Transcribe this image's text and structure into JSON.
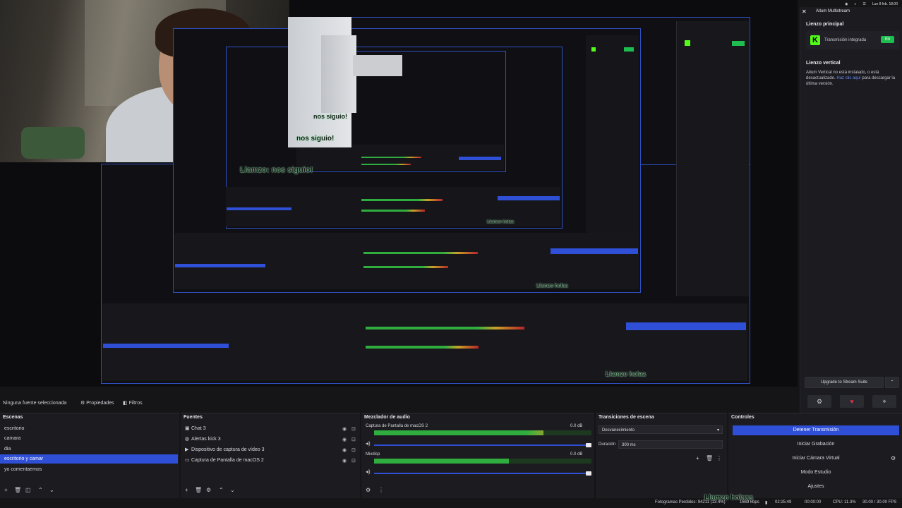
{
  "system_bar": {
    "datetime": "Lun 8 feb. 18:00"
  },
  "stream_dock": {
    "title": "Aitum Multistream",
    "main_section_title": "Lienzo principal",
    "platform_letter": "K",
    "integrated_label": "Transmisión integrada",
    "live_badge": "En",
    "vertical_section_title": "Lienzo vertical",
    "vertical_text_1": "Aitum Vertical no está instalado, o está desactualizado.",
    "vertical_link": "Haz clic aquí",
    "vertical_text_2": "para descargar la última versión.",
    "upgrade_button": "Upgrade to Stream Suite",
    "icons": [
      "gear-icon",
      "heart-icon",
      "pin-icon"
    ]
  },
  "preview": {
    "overlay_texts": [
      "nos siguio!",
      "nos siguio!",
      "Llamzo: nos siguio!",
      "Llamzo holaa"
    ]
  },
  "source_toolbar": {
    "no_source": "Ninguna fuente seleccionada",
    "properties": "Propiedades",
    "filters": "Filtros"
  },
  "scenes": {
    "title": "Escenas",
    "items": [
      "escritorio",
      "camara",
      "dia",
      "escritorio y camar",
      "yo comentaemos"
    ],
    "selected_index": 3
  },
  "sources": {
    "title": "Fuentes",
    "items": [
      {
        "label": "Chat 3",
        "icon": "image-icon"
      },
      {
        "label": "Alertas kick 3",
        "icon": "globe-icon"
      },
      {
        "label": "Dispositivo de captura de vídeo 3",
        "icon": "camera-icon"
      },
      {
        "label": "Captura de Pantalla de macOS 2",
        "icon": "monitor-icon"
      }
    ]
  },
  "mixer": {
    "title": "Mezclador de audio",
    "channels": [
      {
        "name": "Captura de Pantalla de macOS 2",
        "db": "0.0 dB",
        "level": 0.78
      },
      {
        "name": "Mixdisp",
        "db": "0.0 dB",
        "level": 0.62
      }
    ]
  },
  "transitions": {
    "title": "Transiciones de escena",
    "selected": "Desvanecimiento",
    "duration_label": "Duración",
    "duration_value": "300 ms"
  },
  "controls": {
    "title": "Controles",
    "buttons": [
      "Detener Transmisión",
      "Iniciar Grabación",
      "Iniciar Cámara Virtual",
      "Modo Estudio",
      "Ajustes"
    ],
    "active_index": 0
  },
  "statusbar": {
    "dropped": "Fotogramas Perdidos: 94211 (13.4%)",
    "overlay": "Llamzo holaaa",
    "bitrate": "1669 kbps",
    "rec_time": "02:25:49",
    "stream_time": "00:00:00",
    "cpu": "CPU: 11.3%",
    "fps": "30.00 / 30.00 FPS"
  }
}
